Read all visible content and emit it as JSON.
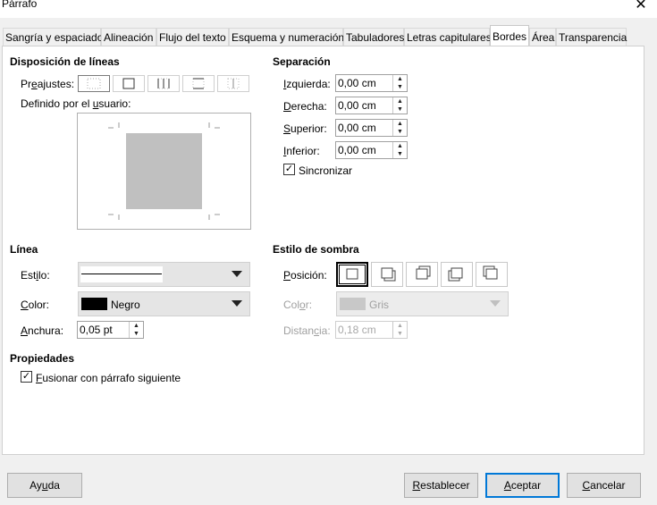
{
  "window": {
    "title": "Párrafo",
    "close_glyph": "✕"
  },
  "tabs": [
    {
      "label": "Sangría y espaciado"
    },
    {
      "label": "Alineación"
    },
    {
      "label": "Flujo del texto"
    },
    {
      "label": "Esquema y numeración"
    },
    {
      "label": "Tabuladores"
    },
    {
      "label": "Letras capitulares"
    },
    {
      "label": "Bordes",
      "active": true
    },
    {
      "label": "Área"
    },
    {
      "label": "Transparencia"
    }
  ],
  "line_arrangement": {
    "heading": "Disposición de líneas",
    "presets_label_pre": "Pr",
    "presets_label_u": "e",
    "presets_label_post": "ajustes:",
    "user_defined_pre": "Definido por el ",
    "user_defined_u": "u",
    "user_defined_post": "suario:"
  },
  "spacing": {
    "heading": "Separación",
    "left": {
      "u": "I",
      "rest": "zquierda:",
      "value": "0,00 cm"
    },
    "right": {
      "u": "D",
      "rest": "erecha:",
      "value": "0,00 cm"
    },
    "top": {
      "u": "S",
      "rest": "uperior:",
      "value": "0,00 cm"
    },
    "bottom": {
      "u": "I",
      "rest": "nferior:",
      "value": "0,00 cm"
    },
    "sync_label": "Sincronizar",
    "sync_checked": "✓"
  },
  "line": {
    "heading": "Línea",
    "style_pre": "Est",
    "style_u": "i",
    "style_post": "lo:",
    "color_u": "C",
    "color_rest": "olor:",
    "color_value": "Negro",
    "color_swatch": "#000000",
    "width_u": "A",
    "width_rest": "nchura:",
    "width_value": "0,05 pt"
  },
  "shadow": {
    "heading": "Estilo de sombra",
    "position_u": "P",
    "position_rest": "osición:",
    "color_pre": "Col",
    "color_u": "o",
    "color_post": "r:",
    "color_value": "Gris",
    "distance_pre": "Distan",
    "distance_u": "c",
    "distance_post": "ia:",
    "distance_value": "0,18 cm"
  },
  "properties": {
    "heading": "Propiedades",
    "merge_u": "F",
    "merge_rest": "usionar con párrafo siguiente",
    "merge_checked": "✓"
  },
  "buttons": {
    "help_pre": "Ay",
    "help_u": "u",
    "help_post": "da",
    "reset_u": "R",
    "reset_rest": "establecer",
    "ok_u": "A",
    "ok_rest": "ceptar",
    "cancel_u": "C",
    "cancel_rest": "ancelar"
  },
  "arrows": {
    "up": "▲",
    "down": "▼"
  }
}
